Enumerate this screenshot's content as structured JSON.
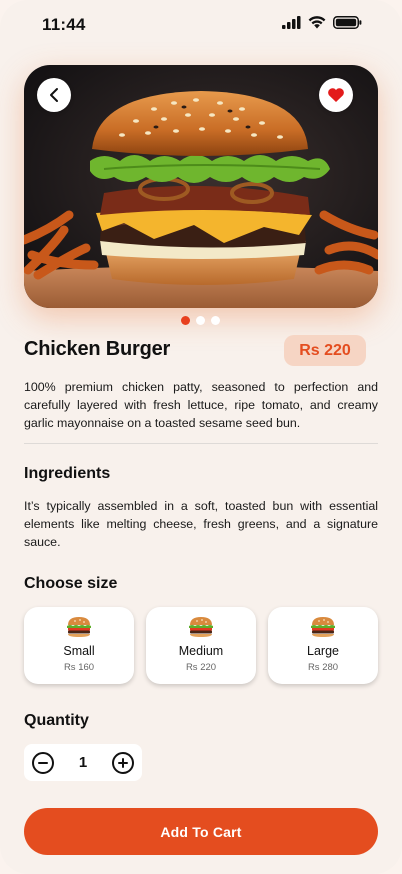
{
  "status_bar": {
    "time": "11:44"
  },
  "product": {
    "name": "Chicken Burger",
    "price": "Rs 220",
    "description": "100% premium chicken patty, seasoned to perfection and carefully layered with fresh lettuce, ripe tomato, and creamy garlic mayonnaise on a toasted sesame seed bun.",
    "image_carousel": {
      "total": 3,
      "active_index": 0
    },
    "favorited": true
  },
  "ingredients": {
    "heading": "Ingredients",
    "text": "It’s typically assembled in a soft, toasted bun with essential elements like melting cheese, fresh greens, and a signature sauce."
  },
  "size_section": {
    "heading": "Choose size",
    "options": [
      {
        "name": "Small",
        "price": "Rs 160"
      },
      {
        "name": "Medium",
        "price": "Rs 220"
      },
      {
        "name": "Large",
        "price": "Rs 280"
      }
    ]
  },
  "quantity": {
    "heading": "Quantity",
    "value": "1"
  },
  "cart_button": {
    "label": "Add To Cart"
  },
  "colors": {
    "accent": "#e44d1f",
    "badge_bg": "#f6d5c4",
    "background": "#f8f1ec"
  },
  "icons": [
    "back-chevron-icon",
    "heart-icon",
    "minus-icon",
    "plus-icon",
    "burger-icon",
    "signal-icon",
    "wifi-icon",
    "battery-icon"
  ]
}
